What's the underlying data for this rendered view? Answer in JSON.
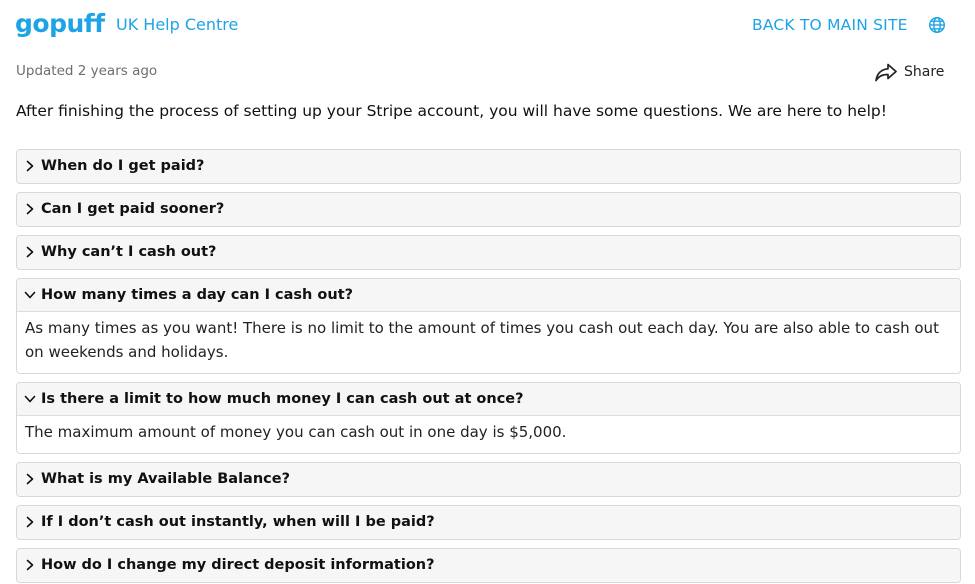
{
  "header": {
    "logo": "gopuff",
    "help_centre": "UK Help Centre",
    "back_link": "BACK TO MAIN SITE",
    "globe_icon": "globe-icon"
  },
  "meta": {
    "updated": "Updated 2 years ago",
    "share_label": "Share",
    "share_icon": "share-arrow-icon"
  },
  "intro": "After finishing the process of setting up your Stripe account, you will have some questions. We are here to help!",
  "colors": {
    "brand": "#1ea3e6",
    "muted_text": "#6e6e6e",
    "faq_header_bg": "#f6f6f6",
    "border": "#d8d8d8"
  },
  "faq": [
    {
      "question": "When do I get paid?",
      "expanded": false,
      "answer": ""
    },
    {
      "question": "Can I get paid sooner?",
      "expanded": false,
      "answer": ""
    },
    {
      "question": "Why can’t I cash out?",
      "expanded": false,
      "answer": ""
    },
    {
      "question": "How many times a day can I cash out?",
      "expanded": true,
      "answer": "As many times as you want! There is no limit to the amount of times you cash out each day. You are also able to cash out on weekends and holidays."
    },
    {
      "question": "Is there a limit to how much money I can cash out at once?",
      "expanded": true,
      "answer": "The maximum amount of money you can cash out in one day is $5,000."
    },
    {
      "question": "What is my Available Balance?",
      "expanded": false,
      "answer": ""
    },
    {
      "question": "If I don’t cash out instantly, when will I be paid?",
      "expanded": false,
      "answer": ""
    },
    {
      "question": "How do I change my direct deposit information?",
      "expanded": false,
      "answer": ""
    }
  ]
}
